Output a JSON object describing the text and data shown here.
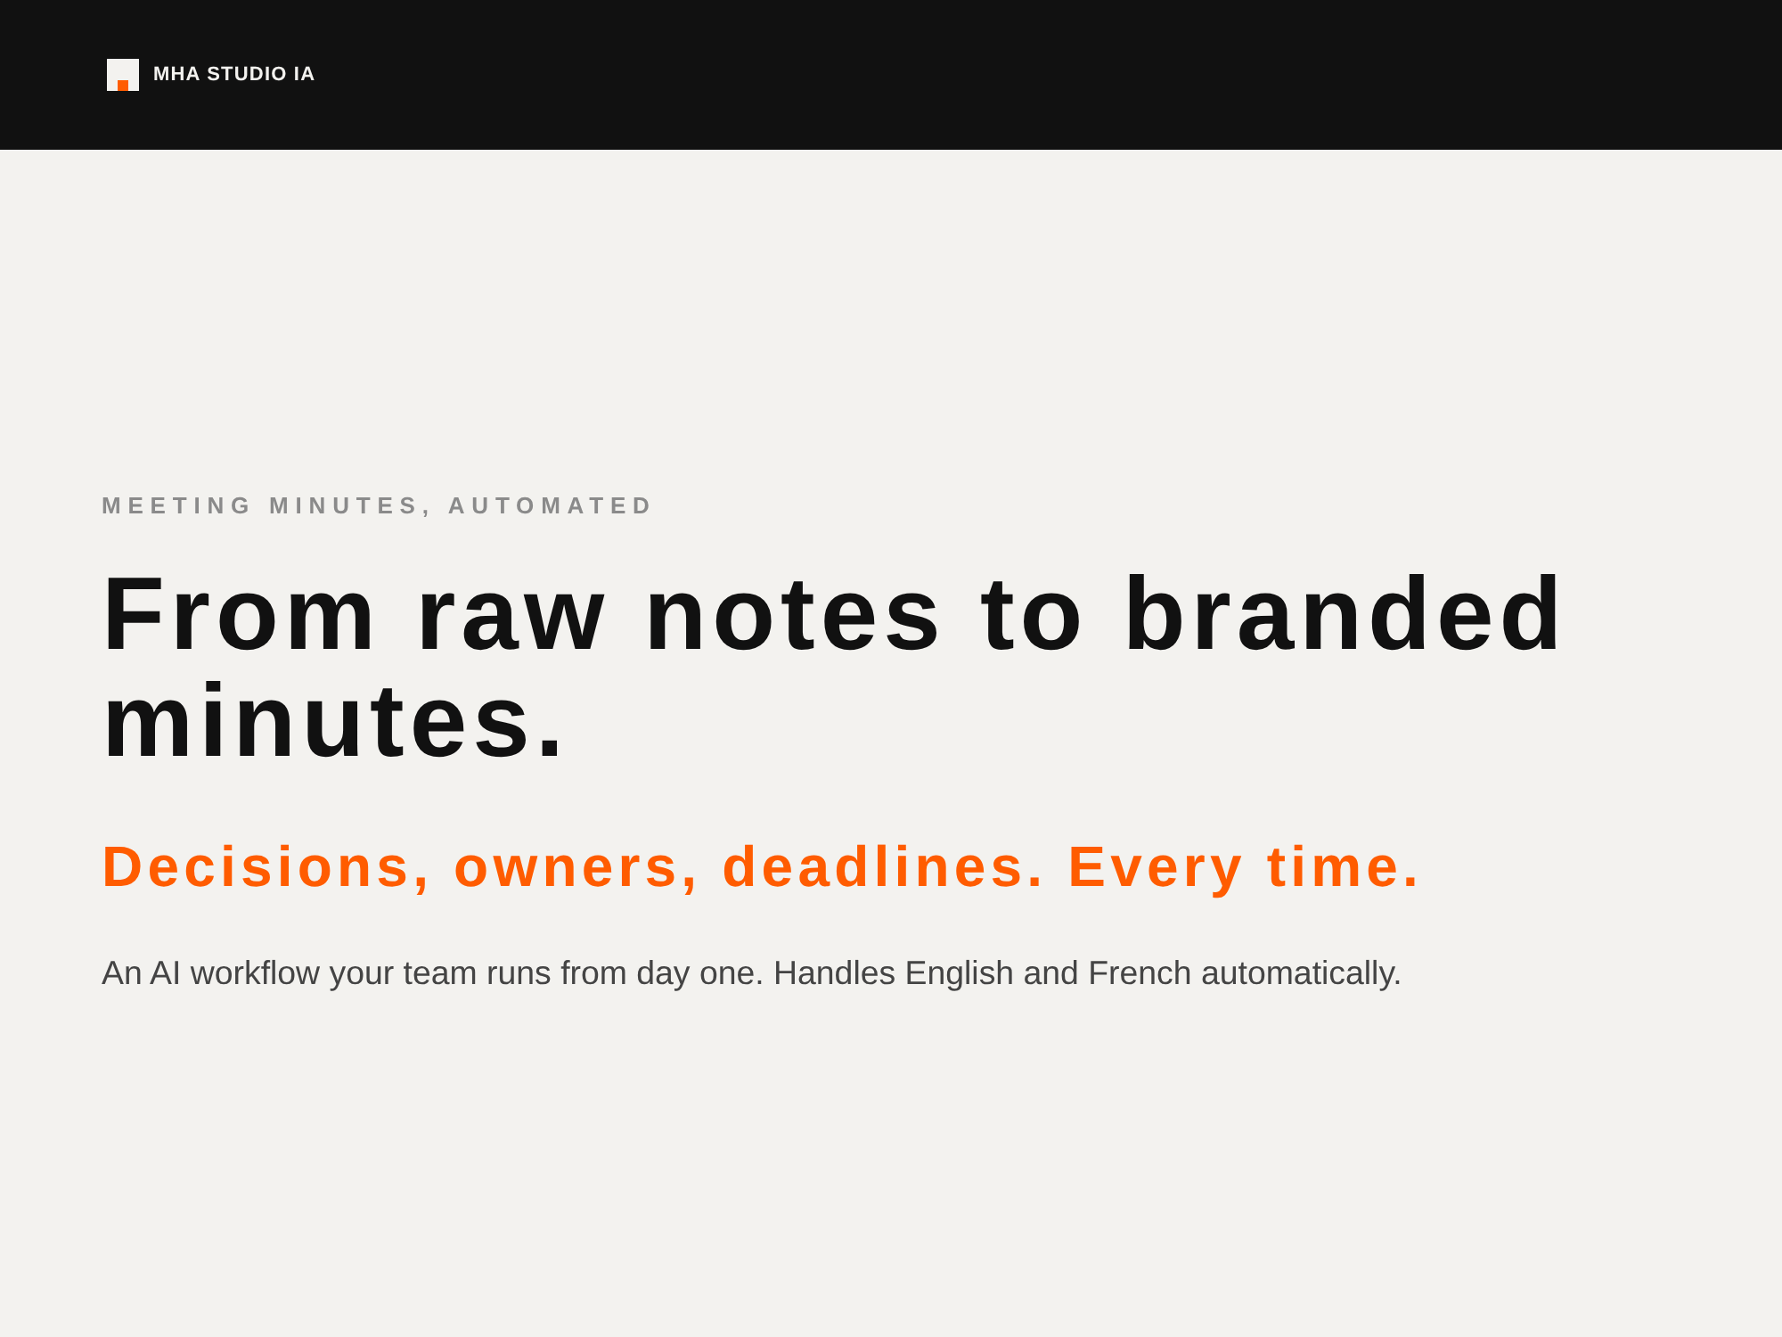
{
  "header": {
    "brand": "MHA STUDIO IA"
  },
  "hero": {
    "eyebrow": "MEETING MINUTES, AUTOMATED",
    "title": "From raw notes to branded minutes.",
    "tagline": "Decisions, owners, deadlines. Every time.",
    "description": "An AI workflow your team runs from day one. Handles English and French automatically."
  }
}
